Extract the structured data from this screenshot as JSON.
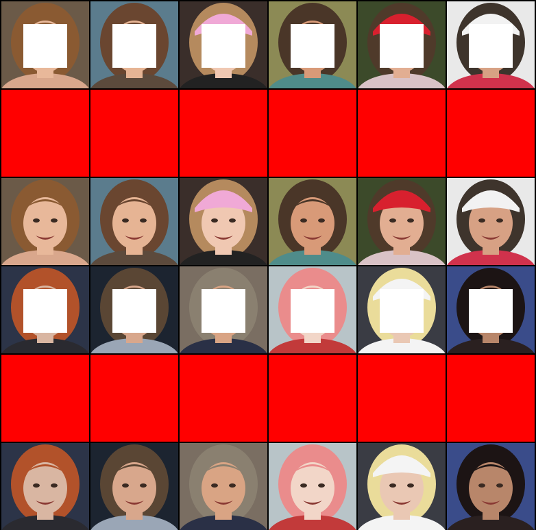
{
  "colors": {
    "separator": "#000000",
    "red_block": "#ff0000",
    "mask": "#ffffff"
  },
  "groups": [
    {
      "faces": [
        {
          "label": "girl-curly-hair",
          "skin": "#e8b89a",
          "hair": "#8a5a32",
          "bg": "#6b5a48",
          "cloth": "#d9a78c",
          "hat": null
        },
        {
          "label": "woman-smiling",
          "skin": "#e6b494",
          "hair": "#6a4630",
          "bg": "#5b7c8d",
          "cloth": "#5c4a3c",
          "hat": null
        },
        {
          "label": "child-pink-hat",
          "skin": "#f0c8b2",
          "hair": "#b58a5e",
          "bg": "#3a2e2a",
          "cloth": "#222222",
          "hat": "#f0a9d6"
        },
        {
          "label": "man-smiling-lighthouse",
          "skin": "#d89a78",
          "hair": "#4a3628",
          "bg": "#8c8a55",
          "cloth": "#4f8c8a",
          "hat": null
        },
        {
          "label": "woman-red-cap",
          "skin": "#e2ae92",
          "hair": "#4f3a2a",
          "bg": "#3c4a2a",
          "cloth": "#d9c2c6",
          "hat": "#d8202e"
        },
        {
          "label": "man-white-cap",
          "skin": "#d7a184",
          "hair": "#3e342c",
          "bg": "#e9e9e9",
          "cloth": "#d0324c",
          "hat": "#f2f2f2"
        }
      ]
    },
    {
      "faces": [
        {
          "label": "boy-red-hair",
          "skin": "#d9b6a2",
          "hair": "#b2522a",
          "bg": "#2c3448",
          "cloth": "#2a2a30",
          "hat": null
        },
        {
          "label": "man-with-child",
          "skin": "#d8a78c",
          "hair": "#5a4634",
          "bg": "#1c2430",
          "cloth": "#9aa6b6",
          "hat": null
        },
        {
          "label": "woman-sunglasses",
          "skin": "#d9a484",
          "hair": "#8a8070",
          "bg": "#7a6e62",
          "cloth": "#2a3046",
          "hat": null
        },
        {
          "label": "cosplay-pink-hair",
          "skin": "#f2d6c8",
          "hair": "#ea8c8c",
          "bg": "#b8c4c8",
          "cloth": "#c23a3a",
          "hat": null
        },
        {
          "label": "white-hood-blonde",
          "skin": "#eac8b4",
          "hair": "#eadc9a",
          "bg": "#3a3c44",
          "cloth": "#f4f4f4",
          "hat": "#f4f4f4"
        },
        {
          "label": "woman-dark-hair-flag",
          "skin": "#b8866a",
          "hair": "#1c1414",
          "bg": "#3a4c8a",
          "cloth": "#2a2020",
          "hat": null
        }
      ]
    }
  ]
}
